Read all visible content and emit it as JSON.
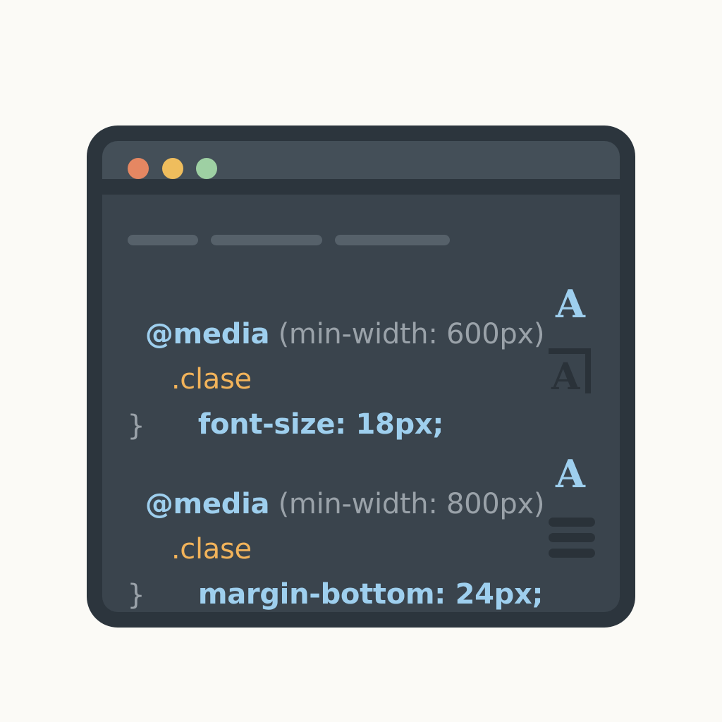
{
  "window": {
    "controls": [
      {
        "name": "close",
        "color": "#e58762"
      },
      {
        "name": "minimize",
        "color": "#efbd5d"
      },
      {
        "name": "maximize",
        "color": "#9ed0a3"
      }
    ],
    "tabs": [
      "",
      "",
      ""
    ]
  },
  "code": {
    "block1": {
      "at_rule": "@media",
      "condition": "(min-width: 600px)",
      "selector": ".clase",
      "declaration": "font-size: 18px;",
      "close_brace": "}"
    },
    "block2": {
      "at_rule": "@media",
      "condition": "(min-width: 800px)",
      "selector": ".clase",
      "declaration": "margin-bottom: 24px;",
      "close_brace": "}"
    }
  },
  "side_icons": {
    "font_icon_1": "A",
    "boxed_font_icon": "A",
    "font_icon_2": "A",
    "menu_icon": "menu-lines-icon"
  },
  "colors": {
    "page_background": "#fbfaf6",
    "window_frame": "#2c353d",
    "titlebar": "#444f58",
    "editor_background": "#3a444d",
    "keyword": "#9ecfee",
    "selector": "#f2b35a",
    "muted": "#9aa2a9"
  }
}
